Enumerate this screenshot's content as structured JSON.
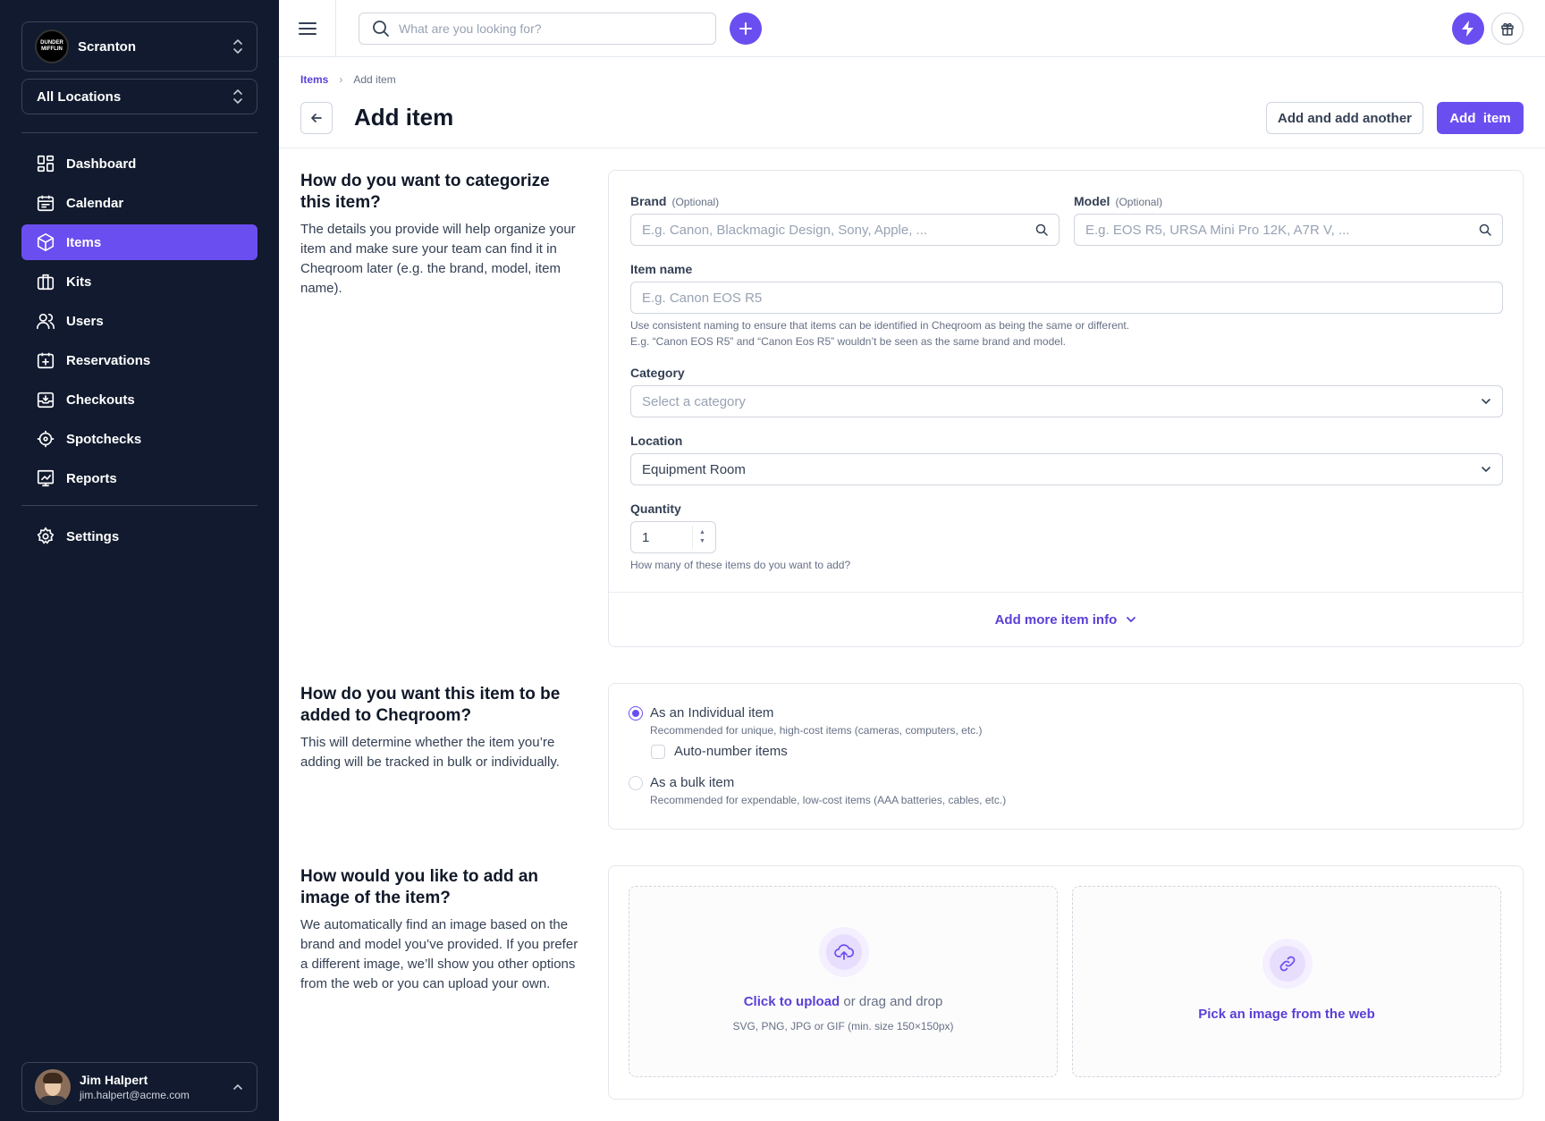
{
  "sidebar": {
    "org_name": "Scranton",
    "org_logo_text": "DUNDER MIFFLIN",
    "location_select": "All Locations",
    "nav": [
      {
        "label": "Dashboard",
        "icon": "dashboard-icon"
      },
      {
        "label": "Calendar",
        "icon": "calendar-icon"
      },
      {
        "label": "Items",
        "icon": "cube-icon"
      },
      {
        "label": "Kits",
        "icon": "kits-icon"
      },
      {
        "label": "Users",
        "icon": "users-icon"
      },
      {
        "label": "Reservations",
        "icon": "reservations-icon"
      },
      {
        "label": "Checkouts",
        "icon": "checkouts-icon"
      },
      {
        "label": "Spotchecks",
        "icon": "spotcheck-icon"
      },
      {
        "label": "Reports",
        "icon": "reports-icon"
      }
    ],
    "active_nav": "Items",
    "settings_label": "Settings",
    "user": {
      "name": "Jim Halpert",
      "email": "jim.halpert@acme.com"
    }
  },
  "topbar": {
    "search_placeholder": "What are you looking for?"
  },
  "header": {
    "breadcrumb": [
      "Items",
      "Add item"
    ],
    "title": "Add item",
    "secondary_button": "Add and add another",
    "primary_button": "Add  item"
  },
  "section_categorize": {
    "title": "How do you want to categorize this item?",
    "description": "The details you provide will help organize your item and make sure your team can find it in Cheqroom later (e.g. the brand, model, item name).",
    "brand": {
      "label": "Brand",
      "optional": "(Optional)",
      "placeholder": "E.g. Canon, Blackmagic Design, Sony, Apple, ..."
    },
    "model": {
      "label": "Model",
      "optional": "(Optional)",
      "placeholder": "E.g. EOS R5, URSA Mini Pro 12K, A7R V, ..."
    },
    "item_name": {
      "label": "Item name",
      "placeholder": "E.g. Canon EOS R5",
      "hint_1": "Use consistent naming to ensure that items can be identified in Cheqroom as being the same or different.",
      "hint_2": "E.g. “Canon EOS R5” and “Canon Eos R5” wouldn’t be seen as the same brand and model."
    },
    "category": {
      "label": "Category",
      "placeholder": "Select a category"
    },
    "location": {
      "label": "Location",
      "value": "Equipment Room"
    },
    "quantity": {
      "label": "Quantity",
      "value": "1",
      "hint": "How many of these items do you want to add?"
    },
    "add_more": "Add more item info"
  },
  "section_tracking": {
    "title": "How do you want this item to be added to Cheqroom?",
    "description": "This will determine whether the item you’re adding will be tracked in bulk or individually.",
    "individual": {
      "label": "As an Individual item",
      "sub": "Recommended for unique, high-cost items (cameras, computers, etc.)",
      "checked": true
    },
    "auto_number": {
      "label": "Auto-number items",
      "checked": false
    },
    "bulk": {
      "label": "As a bulk item",
      "sub": "Recommended for expendable, low-cost items (AAA batteries, cables, etc.)",
      "checked": false
    }
  },
  "section_image": {
    "title": "How would you like to add an image of the item?",
    "description": "We automatically find an image based on the brand and model you’ve provided. If you prefer a different image, we’ll show you other options from the web or you can upload your own.",
    "upload_link": "Click to upload",
    "upload_text": " or drag and drop",
    "upload_formats": "SVG, PNG, JPG or GIF (min. size 150×150px)",
    "web_pick": "Pick an image from the web"
  },
  "colors": {
    "accent": "#6b4ef0",
    "sidebar_bg": "#111a2e",
    "link": "#5b3fd6"
  }
}
